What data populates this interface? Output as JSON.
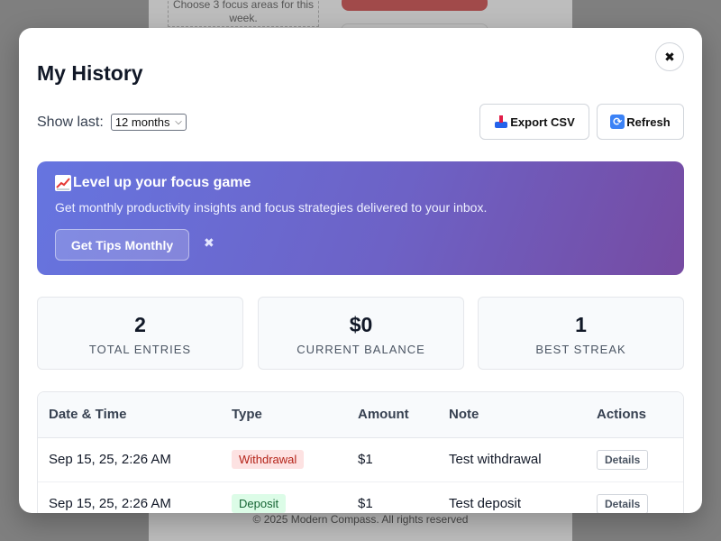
{
  "background": {
    "note": "Choose 3 focus areas for this week.",
    "footer": "© 2025 Modern Compass. All rights reserved"
  },
  "modal": {
    "title": "My History",
    "close_icon": "close-icon",
    "filter": {
      "label": "Show last:",
      "selected": "12 months"
    },
    "toolbar": {
      "export_label": "Export CSV",
      "export_icon": "inbox-tray-icon",
      "refresh_label": "Refresh",
      "refresh_icon": "refresh-icon"
    },
    "promo": {
      "title": "Level up your focus game",
      "icon": "chart-increasing-icon",
      "subtitle": "Get monthly productivity insights and focus strategies delivered to your inbox.",
      "button_label": "Get Tips Monthly",
      "dismiss": "✖",
      "gradient_start": "#6675e0",
      "gradient_end": "#764ba2"
    },
    "stats": [
      {
        "value": "2",
        "label": "TOTAL ENTRIES"
      },
      {
        "value": "$0",
        "label": "CURRENT BALANCE"
      },
      {
        "value": "1",
        "label": "BEST STREAK"
      }
    ],
    "table": {
      "headers": [
        "Date & Time",
        "Type",
        "Amount",
        "Note",
        "Actions"
      ],
      "rows": [
        {
          "date": "Sep 15, 25, 2:26 AM",
          "type": "Withdrawal",
          "amount": "$1",
          "note": "Test withdrawal",
          "action": "Details"
        },
        {
          "date": "Sep 15, 25, 2:26 AM",
          "type": "Deposit",
          "amount": "$1",
          "note": "Test deposit",
          "action": "Details"
        }
      ]
    }
  }
}
